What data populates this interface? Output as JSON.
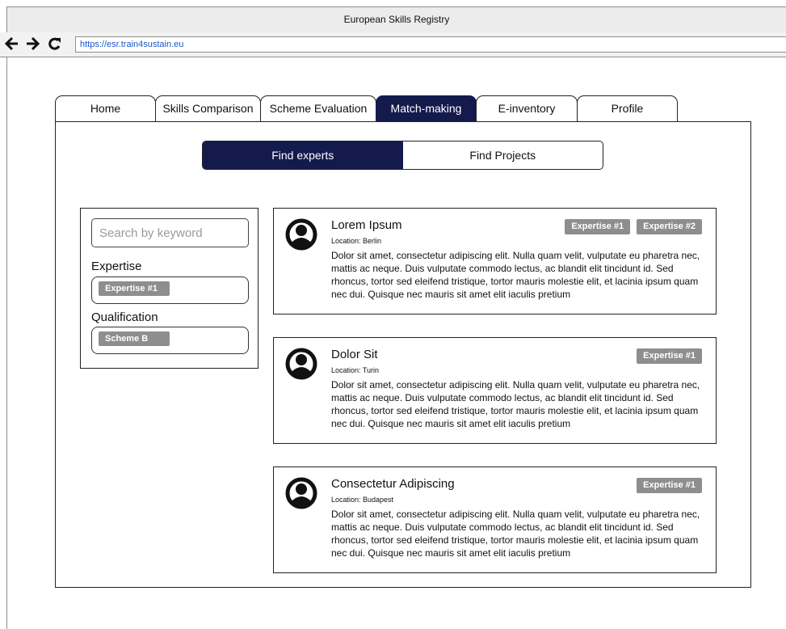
{
  "window": {
    "title": "European Skills Registry"
  },
  "browser": {
    "url": "https://esr.train4sustain.eu"
  },
  "tabs": [
    {
      "label": "Home"
    },
    {
      "label": "Skills Comparison"
    },
    {
      "label": "Scheme Evaluation"
    },
    {
      "label": "Match-making",
      "active": true
    },
    {
      "label": "E-inventory"
    },
    {
      "label": "Profile"
    }
  ],
  "toggle": {
    "left": "Find experts",
    "right": "Find Projects",
    "active": "Find experts"
  },
  "filters": {
    "search_placeholder": "Search by keyword",
    "expertise_label": "Expertise",
    "expertise_chip": "Expertise #1",
    "qualification_label": "Qualification",
    "qualification_chip": "Scheme B"
  },
  "results": [
    {
      "name": "Lorem Ipsum",
      "location": "Location: Berlin",
      "tags": [
        "Expertise #1",
        "Expertise #2"
      ],
      "description": "Dolor sit amet, consectetur adipiscing elit. Nulla quam velit, vulputate eu pharetra nec, mattis ac neque. Duis vulputate commodo lectus, ac blandit elit tincidunt id. Sed rhoncus, tortor sed eleifend tristique, tortor mauris molestie elit, et lacinia ipsum quam nec dui. Quisque nec mauris sit amet elit iaculis pretium"
    },
    {
      "name": "Dolor Sit",
      "location": "Location: Turin",
      "tags": [
        "Expertise #1"
      ],
      "description": "Dolor sit amet, consectetur adipiscing elit. Nulla quam velit, vulputate eu pharetra nec, mattis ac neque. Duis vulputate commodo lectus, ac blandit elit tincidunt id. Sed rhoncus, tortor sed eleifend tristique, tortor mauris molestie elit, et lacinia ipsum quam nec dui. Quisque nec mauris sit amet elit iaculis pretium"
    },
    {
      "name": "Consectetur Adipiscing",
      "location": "Location: Budapest",
      "tags": [
        "Expertise #1"
      ],
      "description": "Dolor sit amet, consectetur adipiscing elit. Nulla quam velit, vulputate eu pharetra nec, mattis ac neque. Duis vulputate commodo lectus, ac blandit elit tincidunt id. Sed rhoncus, tortor sed eleifend tristique, tortor mauris molestie elit, et lacinia ipsum quam nec dui. Quisque nec mauris sit amet elit iaculis pretium"
    }
  ],
  "colors": {
    "accent": "#151a4d",
    "chip": "#8e8e8e",
    "url": "#1a57c9"
  },
  "icons": {
    "back": "arrow-left-icon",
    "forward": "arrow-right-icon",
    "reload": "reload-icon",
    "avatar": "user-avatar-icon"
  }
}
